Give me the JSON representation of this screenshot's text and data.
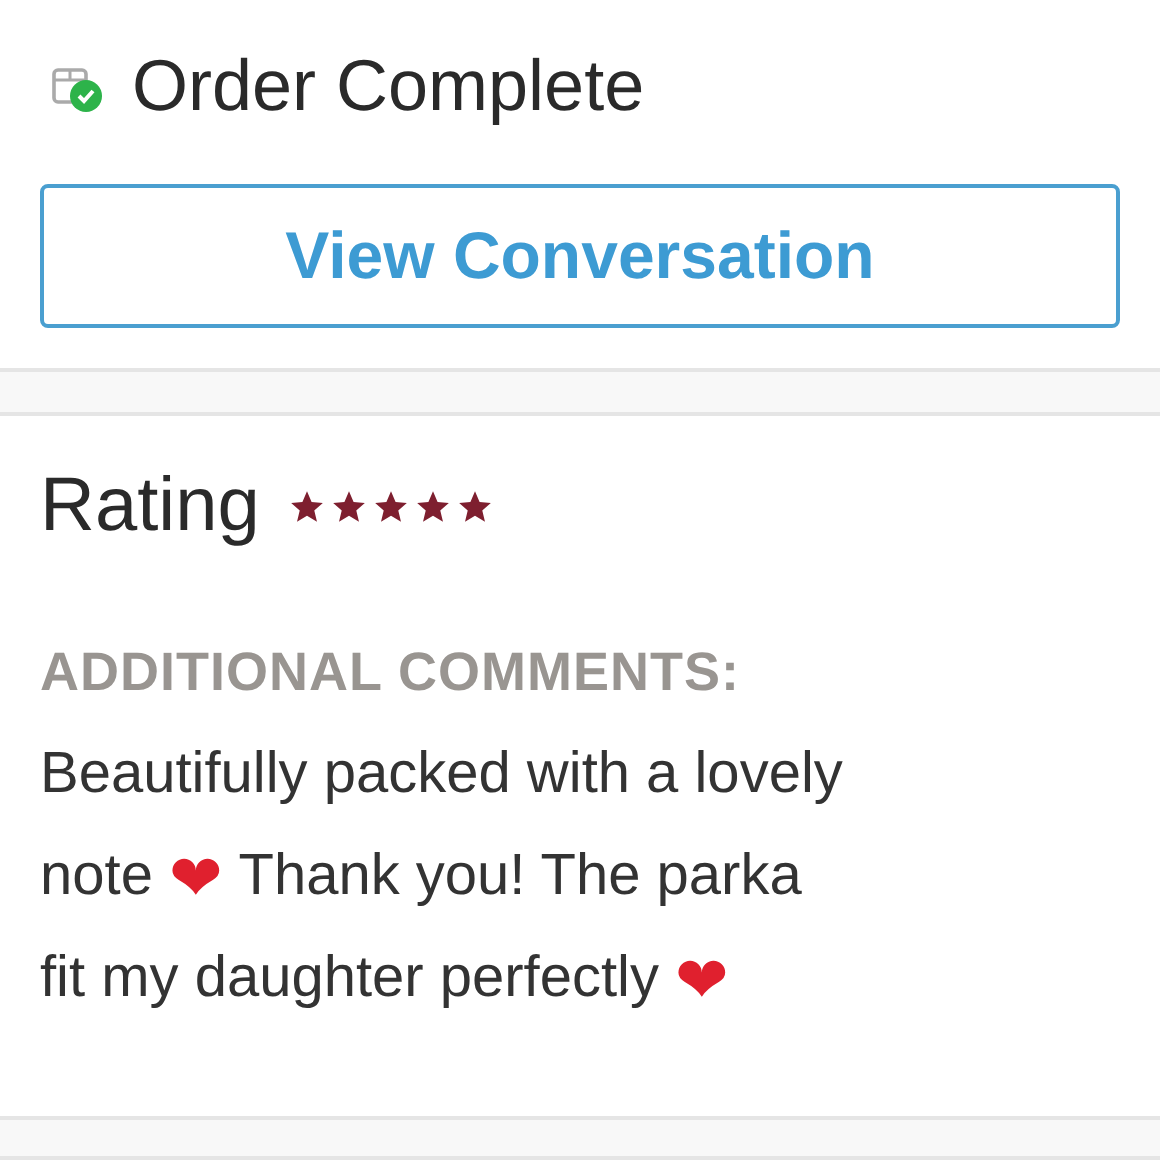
{
  "header": {
    "title": "Order Complete",
    "complete": true
  },
  "button": {
    "label": "View Conversation"
  },
  "rating": {
    "label": "Rating",
    "stars": 5
  },
  "comments": {
    "heading": "ADDITIONAL COMMENTS:",
    "lines": [
      [
        {
          "kind": "text",
          "text": "Beautifully packed with a lovely"
        }
      ],
      [
        {
          "kind": "text",
          "text": "note"
        },
        {
          "kind": "heart",
          "text": "❤"
        },
        {
          "kind": "text",
          "text": "Thank you! The parka"
        }
      ],
      [
        {
          "kind": "text",
          "text": "fit my daughter perfectly"
        },
        {
          "kind": "heart",
          "text": "❤"
        }
      ]
    ]
  }
}
